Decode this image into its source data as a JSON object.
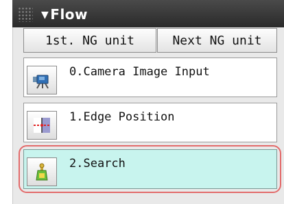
{
  "panel": {
    "title": "Flow",
    "collapse_glyph": "▼"
  },
  "nav": {
    "first_ng": "1st. NG unit",
    "next_ng": "Next NG unit"
  },
  "flow_items": [
    {
      "label": "0.Camera Image Input",
      "icon": "camera-icon"
    },
    {
      "label": "1.Edge Position",
      "icon": "edge-position-icon"
    },
    {
      "label": "2.Search",
      "icon": "search-model-icon",
      "selected": true
    }
  ],
  "colors": {
    "selected_background": "#c8f4ee",
    "selection_outline": "#e36a6a",
    "title_bar": "#3a3a3a"
  }
}
